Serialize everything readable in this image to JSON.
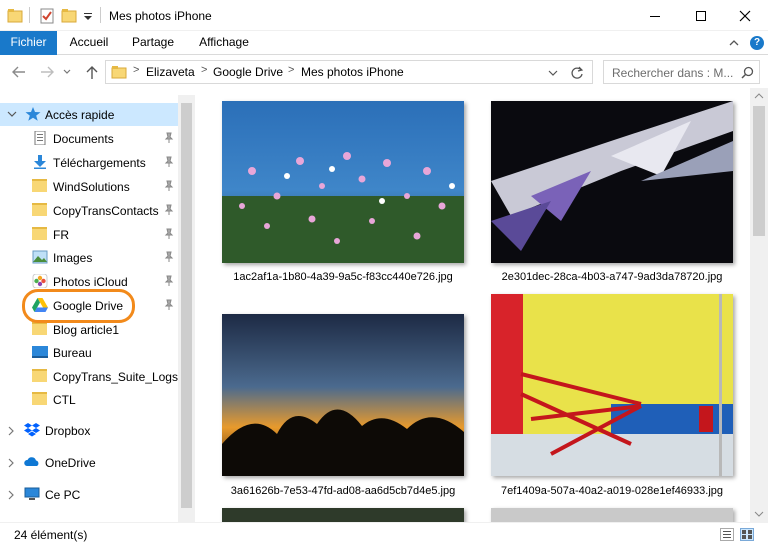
{
  "window": {
    "title": "Mes photos iPhone"
  },
  "ribbon": {
    "tabs": [
      {
        "label": "Fichier",
        "active": true
      },
      {
        "label": "Accueil"
      },
      {
        "label": "Partage"
      },
      {
        "label": "Affichage"
      }
    ],
    "help": "?"
  },
  "address": {
    "breadcrumbs": [
      "Elizaveta",
      "Google Drive",
      "Mes photos iPhone"
    ],
    "search_placeholder": "Rechercher dans : M..."
  },
  "sidebar": {
    "quick_access": "Accès rapide",
    "items": [
      {
        "label": "Documents",
        "icon": "documents-icon",
        "pinned": true
      },
      {
        "label": "Téléchargements",
        "icon": "download-icon",
        "pinned": true
      },
      {
        "label": "WindSolutions",
        "icon": "folder-icon",
        "pinned": true
      },
      {
        "label": "CopyTransContacts",
        "icon": "folder-icon",
        "pinned": true
      },
      {
        "label": "FR",
        "icon": "folder-icon",
        "pinned": true
      },
      {
        "label": "Images",
        "icon": "images-icon",
        "pinned": true
      },
      {
        "label": "Photos iCloud",
        "icon": "icloud-photos-icon",
        "pinned": true
      },
      {
        "label": "Google Drive",
        "icon": "google-drive-icon",
        "pinned": true,
        "highlighted": true
      },
      {
        "label": "Blog article1",
        "icon": "folder-icon"
      },
      {
        "label": "Bureau",
        "icon": "desktop-icon"
      },
      {
        "label": "CopyTrans_Suite_Logs",
        "icon": "folder-icon"
      },
      {
        "label": "CTL",
        "icon": "folder-icon"
      }
    ],
    "roots": [
      {
        "label": "Dropbox",
        "icon": "dropbox-icon"
      },
      {
        "label": "OneDrive",
        "icon": "onedrive-icon"
      },
      {
        "label": "Ce PC",
        "icon": "pc-icon"
      }
    ],
    "highlight_color": "#f28a1b"
  },
  "files": [
    {
      "name": "1ac2af1a-1b80-4a39-9a5c-f83cc440e726.jpg"
    },
    {
      "name": "2e301dec-28ca-4b03-a747-9ad3da78720.jpg"
    },
    {
      "name": "3a61626b-7e53-47fd-ad08-aa6d5cb7d4e5.jpg"
    },
    {
      "name": "7ef1409a-507a-40a2-a019-028e1ef46933.jpg"
    }
  ],
  "status": {
    "count": "24 élément(s)"
  },
  "colors": {
    "accent": "#1979ca",
    "selection": "#cce8ff"
  }
}
